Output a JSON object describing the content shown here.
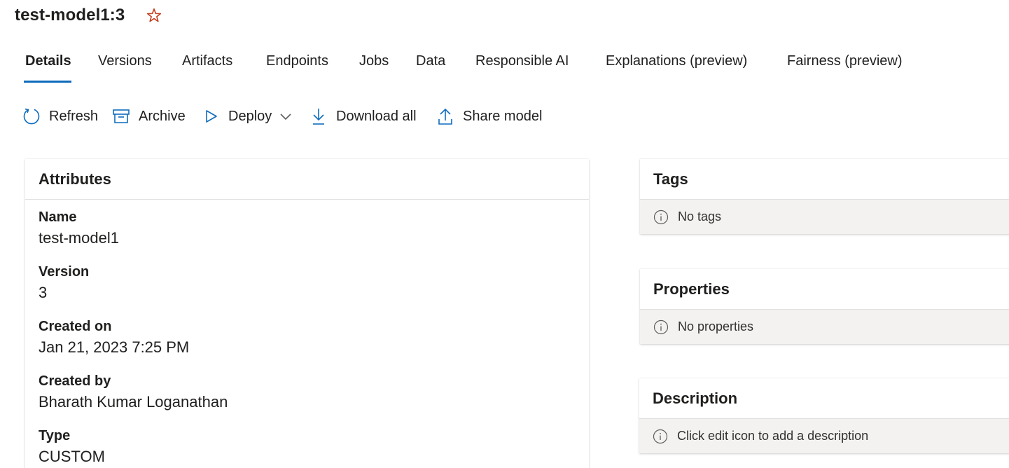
{
  "page": {
    "title": "test-model1:3"
  },
  "tabs": [
    {
      "label": "Details"
    },
    {
      "label": "Versions"
    },
    {
      "label": "Artifacts"
    },
    {
      "label": "Endpoints"
    },
    {
      "label": "Jobs"
    },
    {
      "label": "Data"
    },
    {
      "label": "Responsible AI"
    },
    {
      "label": "Explanations (preview)"
    },
    {
      "label": "Fairness (preview)"
    }
  ],
  "active_tab": "Details",
  "toolbar": {
    "refresh": "Refresh",
    "archive": "Archive",
    "deploy": "Deploy",
    "download_all": "Download all",
    "share_model": "Share model"
  },
  "attributes": {
    "heading": "Attributes",
    "items": [
      {
        "label": "Name",
        "value": "test-model1"
      },
      {
        "label": "Version",
        "value": "3"
      },
      {
        "label": "Created on",
        "value": "Jan 21, 2023 7:25 PM"
      },
      {
        "label": "Created by",
        "value": "Bharath Kumar Loganathan"
      },
      {
        "label": "Type",
        "value": "CUSTOM"
      }
    ]
  },
  "tags": {
    "heading": "Tags",
    "empty_text": "No tags"
  },
  "properties": {
    "heading": "Properties",
    "empty_text": "No properties"
  },
  "description": {
    "heading": "Description",
    "empty_text": "Click edit icon to add a description"
  },
  "icons": {
    "favorite": "star-outline-icon",
    "refresh": "refresh-icon",
    "archive": "archive-icon",
    "deploy": "play-icon",
    "deploy_menu": "chevron-down-icon",
    "download": "download-icon",
    "share": "share-upload-icon",
    "info": "info-icon"
  },
  "colors": {
    "accent": "#0f6cbd",
    "star": "#c43e1c",
    "empty_bg": "#f3f2f1",
    "text": "#201f1e"
  }
}
